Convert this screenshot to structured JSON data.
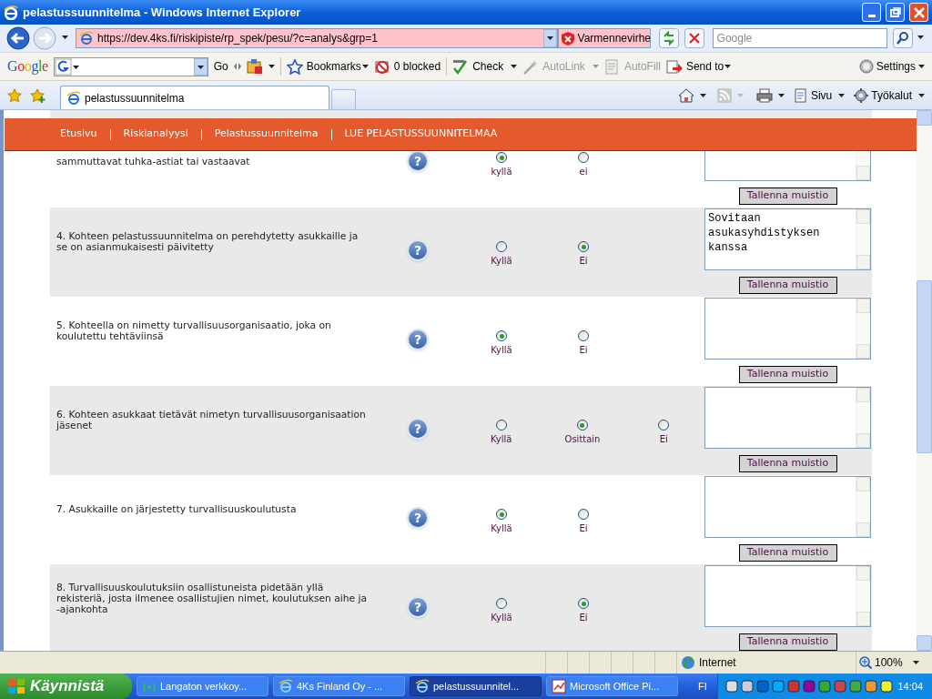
{
  "window": {
    "title": "pelastussuunnitelma - Windows Internet Explorer"
  },
  "address_bar": {
    "url": "https://dev.4ks.fi/riskipiste/rp_spek/pesu/?c=analys&grp=1",
    "certificate_error": "Varmennevirhe"
  },
  "search": {
    "placeholder": "Google"
  },
  "google_toolbar": {
    "logo": "Google",
    "go": "Go",
    "items": [
      {
        "label": "Bookmarks",
        "kind": "menu",
        "disabled": false
      },
      {
        "label": "0 blocked",
        "kind": "button",
        "disabled": false
      },
      {
        "label": "Check",
        "kind": "split",
        "disabled": false
      },
      {
        "label": "AutoLink",
        "kind": "split",
        "disabled": true
      },
      {
        "label": "AutoFill",
        "kind": "button",
        "disabled": true
      },
      {
        "label": "Send to",
        "kind": "menu",
        "disabled": false
      }
    ],
    "settings": "Settings"
  },
  "tabs": [
    {
      "label": "pelastussuunnitelma",
      "selected": true
    }
  ],
  "command_bar": [
    {
      "label": "Sivu"
    },
    {
      "label": "Työkalut"
    }
  ],
  "nav": [
    "Etusivu",
    "Riskianalyysi",
    "Pelastussuunnitelma",
    "LUE PELASTUSSUUNNITELMAA"
  ],
  "questions": [
    {
      "kind": "partial",
      "text": "sammuttavat tuhka-astiat tai vastaavat",
      "help": "?",
      "options": [
        {
          "label": "kyllä",
          "selected": true
        },
        {
          "label": "ei",
          "selected": false
        }
      ],
      "save_button": "Tallenna muistio"
    },
    {
      "kind": "full",
      "text": "4. Kohteen pelastussuunnitelma on perehdytetty asukkaille ja se on asianmukaisesti päivitetty",
      "help": "?",
      "options": [
        {
          "label": "Kyllä",
          "selected": false
        },
        {
          "label": "Ei",
          "selected": true
        }
      ],
      "note": "Sovitaan asukasyhdistyksen kanssa",
      "save_button": "Tallenna muistio"
    },
    {
      "kind": "full",
      "text": "5. Kohteella on nimetty turvallisuusorganisaatio, joka on koulutettu tehtäviinsä",
      "help": "?",
      "options": [
        {
          "label": "Kyllä",
          "selected": true
        },
        {
          "label": "Ei",
          "selected": false
        }
      ],
      "save_button": "Tallenna muistio"
    },
    {
      "kind": "full",
      "text": "6. Kohteen asukkaat tietävät nimetyn turvallisuusorganisaation jäsenet",
      "help": "?",
      "options": [
        {
          "label": "Kyllä",
          "selected": false
        },
        {
          "label": "Osittain",
          "selected": true
        },
        {
          "label": "Ei",
          "selected": false
        }
      ],
      "save_button": "Tallenna muistio"
    },
    {
      "kind": "full",
      "text": "7. Asukkaille on järjestetty turvallisuuskoulutusta",
      "help": "?",
      "options": [
        {
          "label": "Kyllä",
          "selected": true
        },
        {
          "label": "Ei",
          "selected": false
        }
      ],
      "save_button": "Tallenna muistio"
    },
    {
      "kind": "full",
      "text": "8. Turvallisuuskoulutuksiin osallistuneista pidetään yllä rekisteriä, josta ilmenee osallistujien nimet, koulutuksen aihe ja -ajankohta",
      "help": "?",
      "options": [
        {
          "label": "Kyllä",
          "selected": false
        },
        {
          "label": "Ei",
          "selected": true
        }
      ],
      "save_button": "Tallenna muistio"
    }
  ],
  "status_bar": {
    "zone": "Internet",
    "zoom": "100%"
  },
  "taskbar": {
    "start": "Käynnistä",
    "tasks": [
      {
        "label": "Langaton verkkoy...",
        "selected": false
      },
      {
        "label": "4Ks Finland Oy - ...",
        "selected": false
      },
      {
        "label": "pelastussuunnitel...",
        "selected": true
      },
      {
        "label": "Microsoft Office Pi...",
        "selected": false
      }
    ],
    "language": "FI",
    "clock": "14:04"
  }
}
